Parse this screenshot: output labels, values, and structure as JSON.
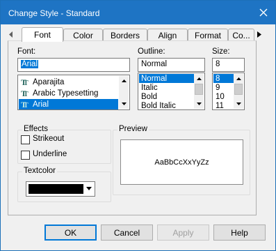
{
  "window": {
    "title": "Change Style - Standard",
    "accent_color": "#1e74c4"
  },
  "tabs": [
    {
      "label": "Font",
      "active": true
    },
    {
      "label": "Color"
    },
    {
      "label": "Borders"
    },
    {
      "label": "Align"
    },
    {
      "label": "Format"
    },
    {
      "label": "Co..."
    }
  ],
  "font": {
    "label": "Font:",
    "value": "Arial",
    "list": [
      {
        "label": "Aparajita",
        "icon": "truetype-icon"
      },
      {
        "label": "Arabic Typesetting",
        "icon": "truetype-icon"
      },
      {
        "label": "Arial",
        "icon": "truetype-icon",
        "selected": true
      }
    ]
  },
  "outline": {
    "label": "Outline:",
    "value": "Normal",
    "list": [
      {
        "label": "Normal",
        "selected": true
      },
      {
        "label": "Italic"
      },
      {
        "label": "Bold"
      },
      {
        "label": "Bold Italic"
      }
    ]
  },
  "size": {
    "label": "Size:",
    "value": "8",
    "list": [
      {
        "label": "8",
        "selected": true
      },
      {
        "label": "9"
      },
      {
        "label": "10"
      },
      {
        "label": "11"
      }
    ]
  },
  "effects": {
    "title": "Effects",
    "strikeout": {
      "label": "Strikeout",
      "checked": false
    },
    "underline": {
      "label": "Underline",
      "checked": false
    }
  },
  "textcolor": {
    "title": "Textcolor",
    "color": "#000000"
  },
  "preview": {
    "title": "Preview",
    "sample": "AaBbCcXxYyZz"
  },
  "buttons": {
    "ok": "OK",
    "cancel": "Cancel",
    "apply": "Apply",
    "help": "Help"
  }
}
